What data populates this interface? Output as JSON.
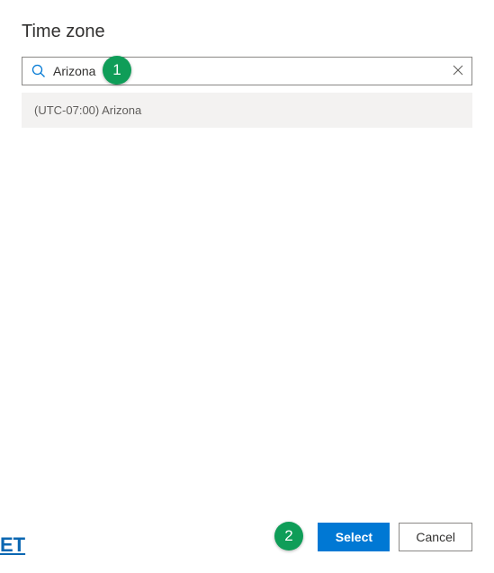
{
  "header": {
    "title": "Time zone"
  },
  "search": {
    "value": "Arizona",
    "placeholder": ""
  },
  "results": {
    "item0": "(UTC-07:00) Arizona"
  },
  "footer": {
    "select_label": "Select",
    "cancel_label": "Cancel"
  },
  "annotations": {
    "one": "1",
    "two": "2"
  },
  "watermark": "ET"
}
